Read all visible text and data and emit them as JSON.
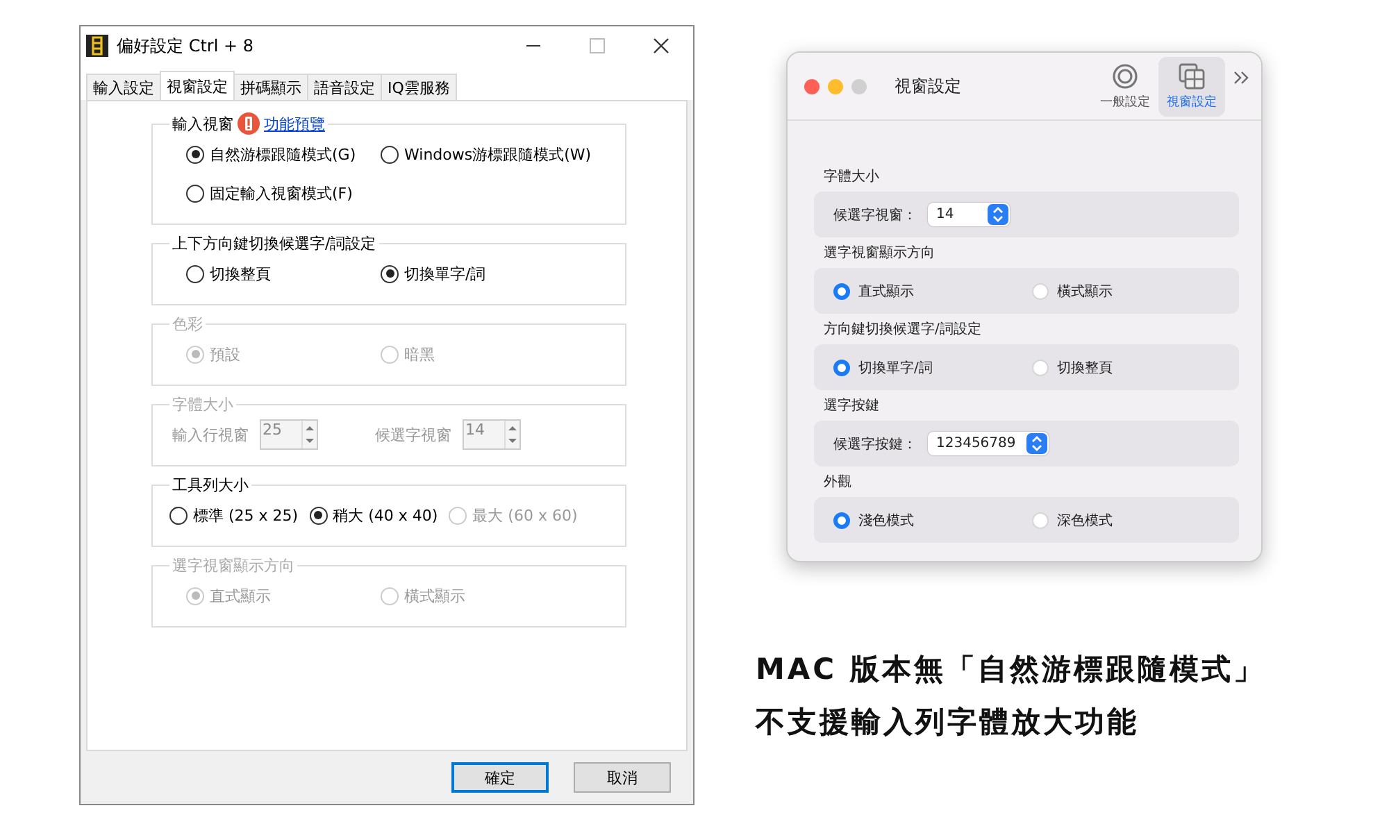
{
  "windows_dialog": {
    "title": "偏好設定 Ctrl + 8",
    "tabs": [
      {
        "label": "輸入設定",
        "selected": false
      },
      {
        "label": "視窗設定",
        "selected": true
      },
      {
        "label": "拼碼顯示",
        "selected": false
      },
      {
        "label": "語音設定",
        "selected": false
      },
      {
        "label": "IQ雲服務",
        "selected": false
      }
    ],
    "groups": [
      {
        "title": "輸入視窗",
        "disabled": false,
        "warning": true,
        "link": "功能預覽",
        "rows": [
          [
            {
              "kind": "radio",
              "label": "自然游標跟隨模式(G)",
              "selected": true,
              "disabled": false
            },
            {
              "kind": "radio",
              "label": "Windows游標跟隨模式(W)",
              "selected": false,
              "disabled": false
            }
          ],
          [
            {
              "kind": "radio",
              "label": "固定輸入視窗模式(F)",
              "selected": false,
              "disabled": false
            }
          ]
        ]
      },
      {
        "title": "上下方向鍵切換候選字/詞設定",
        "disabled": false,
        "rows": [
          [
            {
              "kind": "radio",
              "label": "切換整頁",
              "selected": false,
              "disabled": false
            },
            {
              "kind": "radio",
              "label": "切換單字/詞",
              "selected": true,
              "disabled": false
            }
          ]
        ]
      },
      {
        "title": "色彩",
        "disabled": true,
        "rows": [
          [
            {
              "kind": "radio",
              "label": "預設",
              "selected": true,
              "disabled": true
            },
            {
              "kind": "radio",
              "label": "暗黑",
              "selected": false,
              "disabled": true
            }
          ]
        ]
      },
      {
        "title": "字體大小",
        "disabled": true,
        "rows": [
          [
            {
              "kind": "spin",
              "label": "輸入行視窗",
              "value": "25",
              "disabled": true
            },
            {
              "kind": "spin",
              "label": "候選字視窗",
              "value": "14",
              "disabled": true
            }
          ]
        ]
      },
      {
        "title": "工具列大小",
        "disabled": false,
        "rows": [
          [
            {
              "kind": "radio",
              "label": "標準 (25 x 25)",
              "selected": false,
              "disabled": false
            },
            {
              "kind": "radio",
              "label": "稍大 (40 x 40)",
              "selected": true,
              "disabled": false
            },
            {
              "kind": "radio",
              "label": "最大 (60 x 60)",
              "selected": false,
              "disabled": true
            }
          ]
        ]
      },
      {
        "title": "選字視窗顯示方向",
        "disabled": true,
        "rows": [
          [
            {
              "kind": "radio",
              "label": "直式顯示",
              "selected": true,
              "disabled": true
            },
            {
              "kind": "radio",
              "label": "橫式顯示",
              "selected": false,
              "disabled": true
            }
          ]
        ]
      }
    ],
    "buttons": [
      {
        "label": "確定",
        "default": true
      },
      {
        "label": "取消",
        "default": false
      }
    ]
  },
  "mac_window": {
    "title": "視窗設定",
    "toolbar": [
      {
        "kind": "gear",
        "label": "一般設定",
        "selected": false
      },
      {
        "kind": "windows",
        "label": "視窗設定",
        "selected": true
      }
    ],
    "sections": [
      {
        "title": "字體大小",
        "kind": "popup",
        "label": "候選字視窗：",
        "value": "14"
      },
      {
        "title": "選字視窗顯示方向",
        "kind": "radios",
        "options": [
          {
            "label": "直式顯示",
            "selected": true
          },
          {
            "label": "橫式顯示",
            "selected": false
          }
        ]
      },
      {
        "title": "方向鍵切換候選字/詞設定",
        "kind": "radios",
        "options": [
          {
            "label": "切換單字/詞",
            "selected": true
          },
          {
            "label": "切換整頁",
            "selected": false
          }
        ]
      },
      {
        "title": "選字按鍵",
        "kind": "popup",
        "label": "候選字按鍵：",
        "value": "123456789"
      },
      {
        "title": "外觀",
        "kind": "radios",
        "options": [
          {
            "label": "淺色模式",
            "selected": true
          },
          {
            "label": "深色模式",
            "selected": false
          }
        ]
      }
    ]
  },
  "caption": [
    "MAC 版本無「自然游標跟隨模式」",
    "不支援輸入列字體放大功能"
  ]
}
